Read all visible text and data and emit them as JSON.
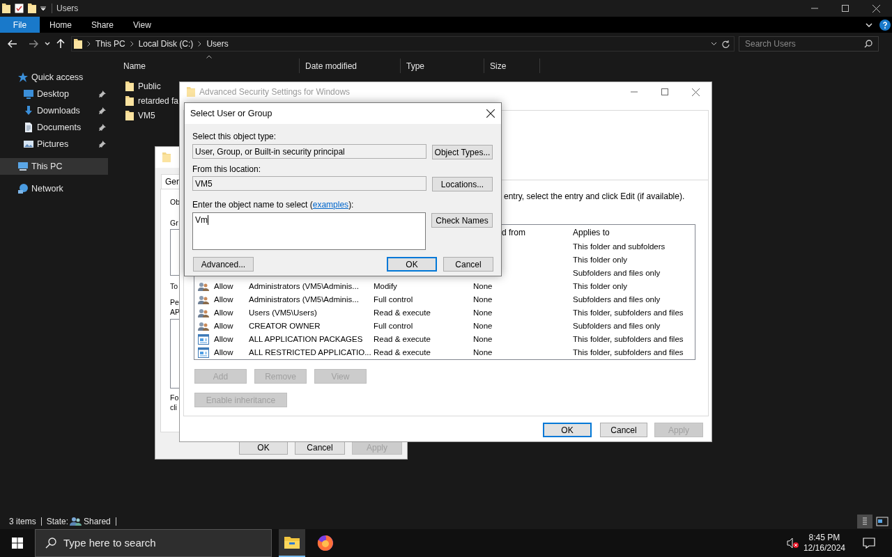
{
  "explorer": {
    "title": "Users",
    "ribbon_tabs": [
      {
        "label": "File",
        "kind": "menu"
      },
      {
        "label": "Home",
        "kind": "tab"
      },
      {
        "label": "Share",
        "kind": "tab"
      },
      {
        "label": "View",
        "kind": "tab"
      }
    ],
    "breadcrumbs": [
      "This PC",
      "Local Disk (C:)",
      "Users"
    ],
    "search": {
      "placeholder": "Search Users"
    },
    "nav": [
      {
        "label": "Quick access",
        "kind": "star",
        "pinned": false,
        "selected": false,
        "children": [
          {
            "label": "Desktop",
            "kind": "desktop",
            "pinned": true,
            "selected": false
          },
          {
            "label": "Downloads",
            "kind": "download",
            "pinned": true,
            "selected": false
          },
          {
            "label": "Documents",
            "kind": "document",
            "pinned": true,
            "selected": false
          },
          {
            "label": "Pictures",
            "kind": "picture",
            "pinned": true,
            "selected": false
          }
        ]
      },
      {
        "label": "This PC",
        "kind": "pc",
        "pinned": false,
        "selected": true
      },
      {
        "label": "Network",
        "kind": "network",
        "pinned": false,
        "selected": false
      }
    ],
    "columns": [
      "Name",
      "Date modified",
      "Type",
      "Size"
    ],
    "files": [
      "Public",
      "retarded fa",
      "VM5"
    ],
    "status": {
      "count": "3 items",
      "state_label": "State:",
      "state_value": "Shared"
    }
  },
  "properties": {
    "tab": "Gen",
    "labels": [
      "Ob",
      "Gr",
      "To",
      "Pe",
      "AP",
      "Fo",
      "cli"
    ],
    "buttons": [
      {
        "label": "OK",
        "disabled": false
      },
      {
        "label": "Cancel",
        "disabled": false
      },
      {
        "label": "Apply",
        "disabled": true
      }
    ]
  },
  "advanced": {
    "title": "Advanced Security Settings for Windows",
    "hint": "entry, select the entry and click Edit (if available).",
    "columns": [
      "d from",
      "Applies to"
    ],
    "entries": [
      {
        "applies": "This folder and subfolders"
      },
      {
        "applies": "This folder only"
      },
      {
        "applies": "Subfolders and files only"
      },
      {
        "kind": "group",
        "type": "Allow",
        "principal": "Administrators (VM5\\Adminis...",
        "access": "Modify",
        "inherited": "None",
        "applies": "This folder only"
      },
      {
        "kind": "group",
        "type": "Allow",
        "principal": "Administrators (VM5\\Adminis...",
        "access": "Full control",
        "inherited": "None",
        "applies": "Subfolders and files only"
      },
      {
        "kind": "group",
        "type": "Allow",
        "principal": "Users (VM5\\Users)",
        "access": "Read & execute",
        "inherited": "None",
        "applies": "This folder, subfolders and files"
      },
      {
        "kind": "group",
        "type": "Allow",
        "principal": "CREATOR OWNER",
        "access": "Full control",
        "inherited": "None",
        "applies": "Subfolders and files only"
      },
      {
        "kind": "package",
        "type": "Allow",
        "principal": "ALL APPLICATION PACKAGES",
        "access": "Read & execute",
        "inherited": "None",
        "applies": "This folder, subfolders and files"
      },
      {
        "kind": "package",
        "type": "Allow",
        "principal": "ALL RESTRICTED APPLICATIO...",
        "access": "Read & execute",
        "inherited": "None",
        "applies": "This folder, subfolders and files"
      }
    ],
    "buttons": [
      {
        "label": "Add",
        "disabled": true
      },
      {
        "label": "Remove",
        "disabled": true
      },
      {
        "label": "View",
        "disabled": true
      }
    ],
    "inheritance_button": {
      "label": "Enable inheritance",
      "disabled": true
    },
    "dialog_buttons": [
      {
        "label": "OK",
        "disabled": false,
        "default": true
      },
      {
        "label": "Cancel",
        "disabled": false,
        "default": false
      },
      {
        "label": "Apply",
        "disabled": true,
        "default": false
      }
    ]
  },
  "select": {
    "title": "Select User or Group",
    "fields": [
      {
        "label": "Select this object type:",
        "value": "User, Group, or Built-in security principal",
        "button": "Object Types..."
      },
      {
        "label": "From this location:",
        "value": "VM5",
        "button": "Locations..."
      }
    ],
    "name_field": {
      "label_before": "Enter the object name to select (",
      "link": "examples",
      "label_after": "):",
      "value": "Vm",
      "button": "Check Names"
    },
    "buttons": [
      {
        "label": "Advanced...",
        "default": false
      },
      {
        "label": "OK",
        "default": true
      },
      {
        "label": "Cancel",
        "default": false
      }
    ]
  },
  "taskbar": {
    "search_placeholder": "Type here to search",
    "apps": [
      {
        "kind": "explorer",
        "active": true
      },
      {
        "kind": "browser",
        "active": false
      }
    ],
    "muted": true,
    "time": "8:45 PM",
    "date": "12/16/2024"
  }
}
